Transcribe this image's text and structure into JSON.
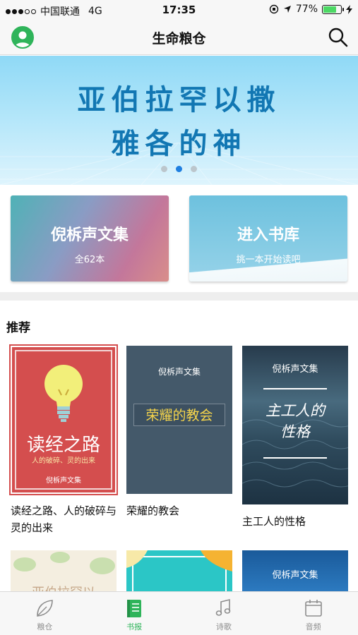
{
  "status_bar": {
    "carrier": "中国联通",
    "network": "4G",
    "time": "17:35",
    "battery_text": "77%",
    "battery_level": 0.77
  },
  "nav": {
    "title": "生命粮仓"
  },
  "banner": {
    "line1": "亚伯拉罕以撒",
    "line2": "雅各的神",
    "pages": 3,
    "active_page": 1
  },
  "quick_cards": [
    {
      "title": "倪柝声文集",
      "subtitle": "全62本"
    },
    {
      "title": "进入书库",
      "subtitle": "挑一本开始读吧"
    }
  ],
  "recommend": {
    "heading": "推荐",
    "books": [
      {
        "cover_main": "读经之路",
        "cover_sub": "人的破碎、灵的出来",
        "cover_series": "倪柝声文集",
        "title": "读经之路、人的破碎与灵的出来"
      },
      {
        "cover_series": "倪柝声文集",
        "cover_main": "荣耀的教会",
        "title": "荣耀的教会"
      },
      {
        "cover_series": "倪柝声文集",
        "cover_main_1": "主工人的",
        "cover_main_2": "性格",
        "title": "主工人的性格"
      }
    ],
    "row2_partial": [
      {
        "cover_text": "亚伯拉罕以"
      },
      {
        "cover_text": ""
      },
      {
        "cover_series": "倪柝声文集"
      }
    ]
  },
  "tabs": [
    {
      "label": "粮仓",
      "icon": "leaf-icon",
      "active": false
    },
    {
      "label": "书报",
      "icon": "book-icon",
      "active": true
    },
    {
      "label": "诗歌",
      "icon": "music-note-icon",
      "active": false
    },
    {
      "label": "音频",
      "icon": "calendar-icon",
      "active": false
    }
  ],
  "colors": {
    "accent_green": "#2fb45a",
    "banner_text": "#1277b3",
    "pager_active": "#1f7fe0"
  }
}
